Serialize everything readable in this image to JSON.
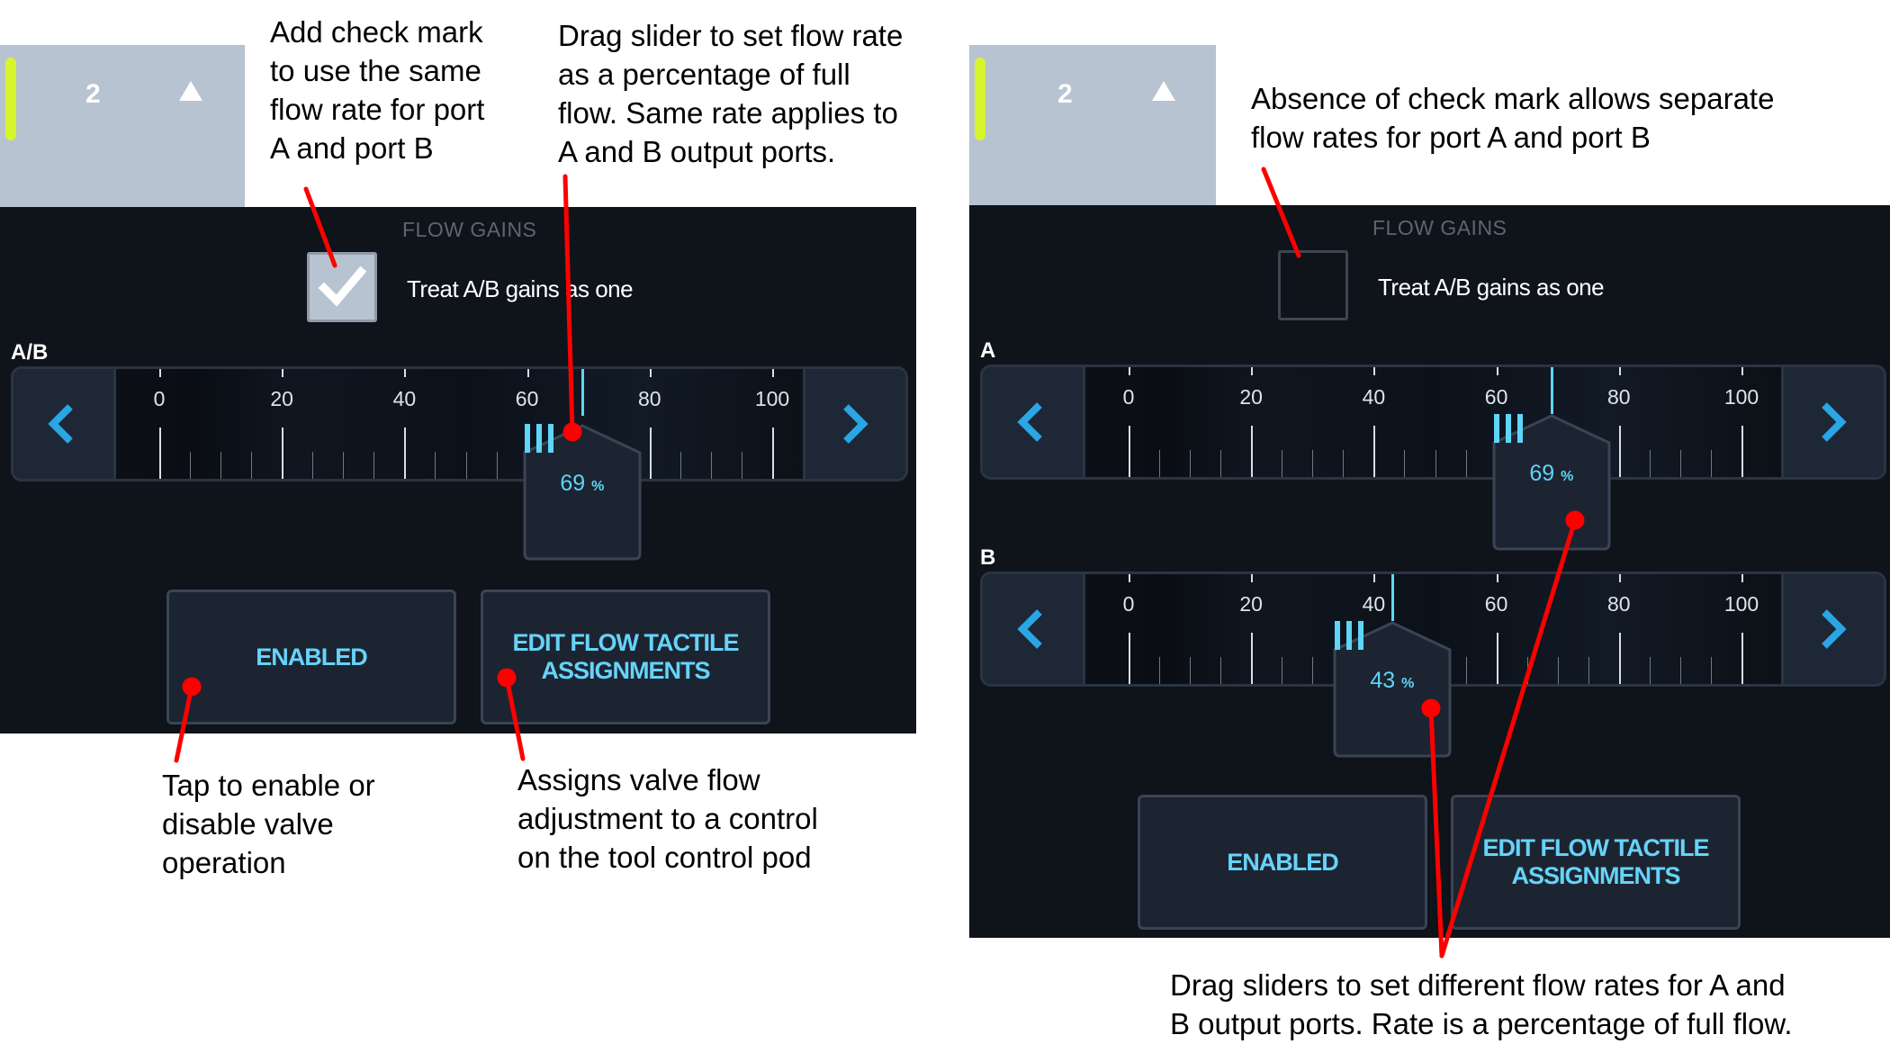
{
  "panels": [
    {
      "id": "left",
      "tab": {
        "number": "2"
      },
      "section_title": "FLOW GAINS",
      "checkbox": {
        "checked": true,
        "label": "Treat A/B gains as one"
      },
      "sliders": [
        {
          "label": "A/B",
          "value": 69,
          "value_text": "69",
          "unit": "%"
        }
      ],
      "buttons": {
        "enabled": "ENABLED",
        "edit": [
          "EDIT FLOW TACTILE",
          "ASSIGNMENTS"
        ]
      }
    },
    {
      "id": "right",
      "tab": {
        "number": "2"
      },
      "section_title": "FLOW GAINS",
      "checkbox": {
        "checked": false,
        "label": "Treat A/B gains as one"
      },
      "sliders": [
        {
          "label": "A",
          "value": 69,
          "value_text": "69",
          "unit": "%"
        },
        {
          "label": "B",
          "value": 43,
          "value_text": "43",
          "unit": "%"
        }
      ],
      "buttons": {
        "enabled": "ENABLED",
        "edit": [
          "EDIT FLOW TACTILE",
          "ASSIGNMENTS"
        ]
      }
    }
  ],
  "slider_scale": {
    "min": 0,
    "max": 100,
    "tick_labels": [
      "0",
      "20",
      "40",
      "60",
      "80",
      "100"
    ]
  },
  "notes": {
    "check_mark": [
      "Add check mark",
      "to use the same",
      "flow rate for port",
      "A and port B"
    ],
    "drag_slider": [
      "Drag slider to set flow rate",
      "as a percentage of full",
      "flow. Same rate applies to",
      "A and B output ports."
    ],
    "tap_enable": [
      "Tap to enable or",
      "disable valve",
      "operation"
    ],
    "assigns": [
      "Assigns valve flow",
      "adjustment to a control",
      "on the tool control pod"
    ],
    "absence": [
      "Absence of check mark allows separate",
      "flow rates for port A and port B"
    ],
    "drag_sliders": [
      "Drag sliders to set different flow rates for A and",
      "B output ports. Rate is a percentage of full flow."
    ]
  },
  "colors": {
    "panel": "#0f131a",
    "tab": "#b7c3d0",
    "tab_stripe": "#d7f52d",
    "accent": "#5fd5f8",
    "callout_line": "#ff0000"
  },
  "icons": {
    "tab_arrow": "up-triangle-icon",
    "slider_left": "chevron-left-icon",
    "slider_right": "chevron-right-icon",
    "thumb_grip": "grip-lines-icon",
    "check": "checkmark-icon"
  }
}
